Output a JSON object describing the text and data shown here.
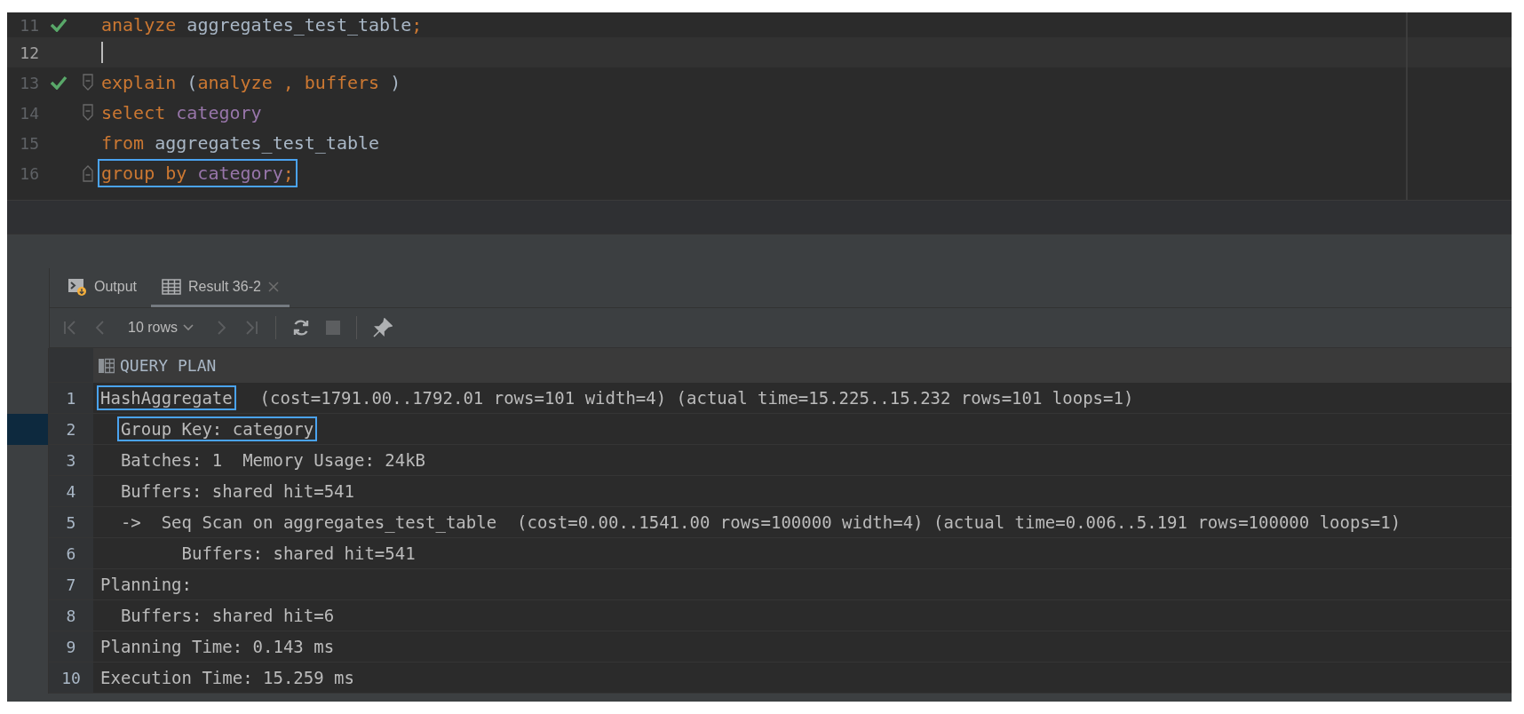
{
  "editor": {
    "lines": [
      {
        "number": "11",
        "executed": true,
        "current": false,
        "cursor": false,
        "fold_start": false,
        "fold_end": false,
        "highlighted": false,
        "tokens": [
          {
            "kind": "keyword",
            "text": "analyze"
          },
          {
            "kind": "plain",
            "text": " aggregates_test_table"
          },
          {
            "kind": "keyword",
            "text": ";"
          }
        ]
      },
      {
        "number": "12",
        "executed": false,
        "current": true,
        "cursor": true,
        "fold_start": false,
        "fold_end": false,
        "highlighted": false
      },
      {
        "number": "13",
        "executed": true,
        "current": false,
        "cursor": false,
        "fold_start": true,
        "fold_end": false,
        "highlighted": false,
        "tokens": [
          {
            "kind": "keyword",
            "text": "explain"
          },
          {
            "kind": "plain",
            "text": " ("
          },
          {
            "kind": "keyword",
            "text": "analyze , buffers"
          },
          {
            "kind": "plain",
            "text": " )"
          }
        ]
      },
      {
        "number": "14",
        "executed": false,
        "current": false,
        "cursor": false,
        "fold_start": true,
        "fold_end": false,
        "highlighted": false,
        "tokens": [
          {
            "kind": "keyword",
            "text": "select"
          },
          {
            "kind": "column",
            "text": " category"
          }
        ]
      },
      {
        "number": "15",
        "executed": false,
        "current": false,
        "cursor": false,
        "fold_start": false,
        "fold_end": false,
        "highlighted": false,
        "tokens": [
          {
            "kind": "keyword",
            "text": "from"
          },
          {
            "kind": "plain",
            "text": " aggregates_test_table"
          }
        ]
      },
      {
        "number": "16",
        "executed": false,
        "current": false,
        "cursor": false,
        "fold_start": false,
        "fold_end": true,
        "highlighted": true,
        "tokens": [
          {
            "kind": "keyword",
            "text": "group by"
          },
          {
            "kind": "column",
            "text": " category"
          },
          {
            "kind": "keyword",
            "text": ";"
          }
        ]
      }
    ]
  },
  "results": {
    "tabs": [
      {
        "kind": "output",
        "label": "Output",
        "selected": false,
        "closable": false
      },
      {
        "kind": "result",
        "label": "Result 36-2",
        "selected": true,
        "closable": true
      }
    ],
    "toolbar": {
      "rows_label": "10 rows"
    },
    "column": "QUERY PLAN",
    "rows": [
      {
        "number": "1",
        "selected": false,
        "segments": [
          {
            "text": "HashAggregate",
            "highlighted": true
          },
          {
            "text": "  (cost=1791.00..1792.01 rows=101 width=4) (actual time=15.225..15.232 rows=101 loops=1)",
            "highlighted": false
          }
        ]
      },
      {
        "number": "2",
        "selected": true,
        "segments": [
          {
            "text": "  Group Key: category",
            "highlighted": true
          }
        ]
      },
      {
        "number": "3",
        "selected": false,
        "segments": [
          {
            "text": "  Batches: 1  Memory Usage: 24kB",
            "highlighted": false
          }
        ]
      },
      {
        "number": "4",
        "selected": false,
        "segments": [
          {
            "text": "  Buffers: shared hit=541",
            "highlighted": false
          }
        ]
      },
      {
        "number": "5",
        "selected": false,
        "segments": [
          {
            "text": "  ->  Seq Scan on aggregates_test_table  (cost=0.00..1541.00 rows=100000 width=4) (actual time=0.006..5.191 rows=100000 loops=1)",
            "highlighted": false
          }
        ]
      },
      {
        "number": "6",
        "selected": false,
        "segments": [
          {
            "text": "        Buffers: shared hit=541",
            "highlighted": false
          }
        ]
      },
      {
        "number": "7",
        "selected": false,
        "segments": [
          {
            "text": "Planning:",
            "highlighted": false
          }
        ]
      },
      {
        "number": "8",
        "selected": false,
        "segments": [
          {
            "text": "  Buffers: shared hit=6",
            "highlighted": false
          }
        ]
      },
      {
        "number": "9",
        "selected": false,
        "segments": [
          {
            "text": "Planning Time: 0.143 ms",
            "highlighted": false
          }
        ]
      },
      {
        "number": "10",
        "selected": false,
        "segments": [
          {
            "text": "Execution Time: 15.259 ms",
            "highlighted": false
          }
        ]
      }
    ]
  }
}
